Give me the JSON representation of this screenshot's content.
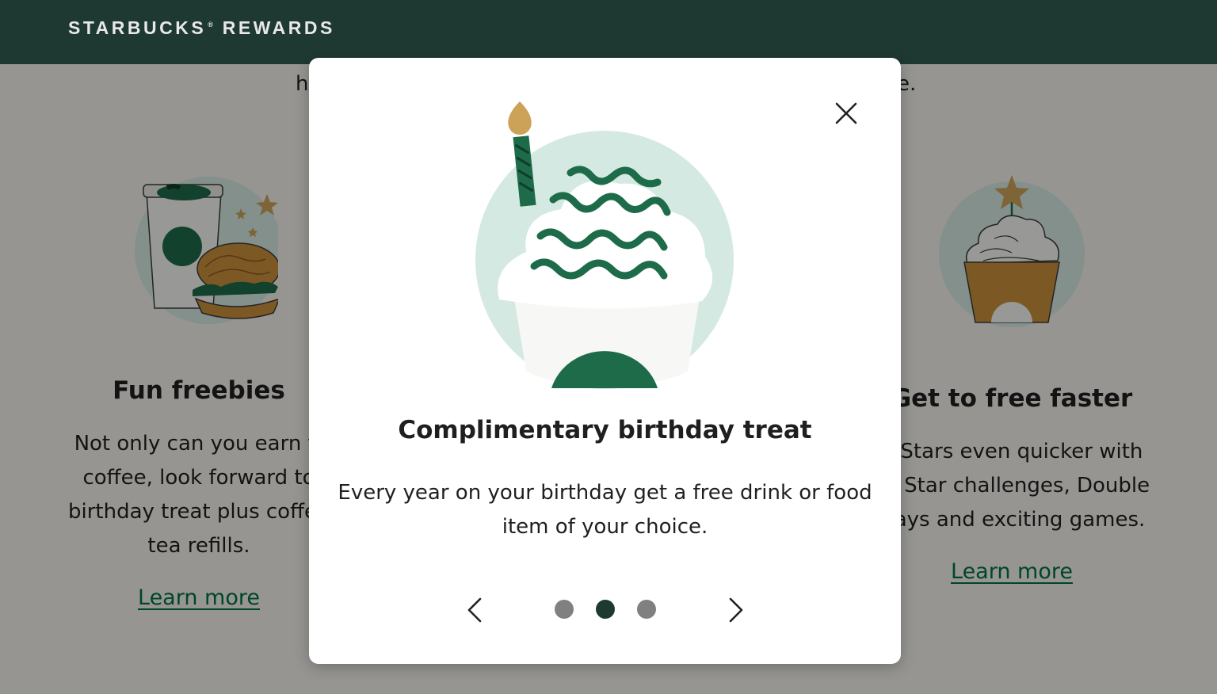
{
  "header": {
    "brand_main": "STARBUCKS",
    "brand_reg": "®",
    "brand_suffix": "REWARDS"
  },
  "background": {
    "intro_left_fragment": "h",
    "intro_right_fragment": "e.",
    "cards": [
      {
        "illustration": "coffee-cup-and-sandwich-icon",
        "title": "Fun freebies",
        "desc_lines": [
          "Not only can you earn fr",
          "coffee, look forward to",
          "birthday treat plus coffee",
          "tea refills."
        ],
        "link": "Learn more"
      },
      {
        "illustration": "frappuccino-with-star-icon",
        "title": "Get to free faster",
        "desc_lines": [
          "n Stars even quicker with",
          "us Star challenges, Double",
          "Days and exciting games."
        ],
        "link": "Learn more"
      }
    ]
  },
  "modal": {
    "close_icon": "close-icon",
    "illustration": "birthday-cupcake-candle-icon",
    "title": "Complimentary birthday treat",
    "body": "Every year on your birthday get a free drink or food item of your choice.",
    "carousel": {
      "prev_icon": "chevron-left-icon",
      "next_icon": "chevron-right-icon",
      "total_slides": 3,
      "active_slide": 2
    }
  },
  "colors": {
    "header_bg": "#1e3932",
    "accent_green": "#00704a",
    "dark_green": "#1e6b4a",
    "light_mint": "#d4e9e2",
    "gold": "#cba258",
    "dot_active": "#1e3932",
    "dot_inactive": "#808080"
  }
}
